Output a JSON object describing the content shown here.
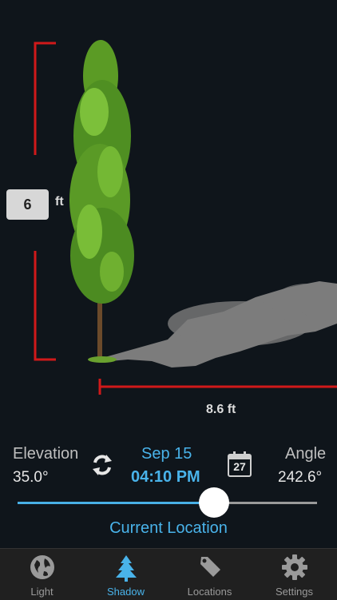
{
  "scene": {
    "height_value": "6",
    "height_unit": "ft",
    "shadow_length": "8.6 ft"
  },
  "controls": {
    "elevation_label": "Elevation",
    "elevation_value": "35.0°",
    "date": "Sep 15",
    "time": "04:10 PM",
    "calendar_day": "27",
    "angle_label": "Angle",
    "angle_value": "242.6°",
    "time_slider_fraction": 0.66,
    "location_label": "Current Location"
  },
  "tabbar": {
    "items": [
      {
        "label": "Light",
        "icon": "globe-icon",
        "active": false
      },
      {
        "label": "Shadow",
        "icon": "tree-icon",
        "active": true
      },
      {
        "label": "Locations",
        "icon": "tag-icon",
        "active": false
      },
      {
        "label": "Settings",
        "icon": "gear-icon",
        "active": false
      }
    ]
  },
  "colors": {
    "accent": "#49b3ea",
    "measure_red": "#d0191a",
    "background": "#0f151b",
    "tab_bar": "#202020"
  }
}
